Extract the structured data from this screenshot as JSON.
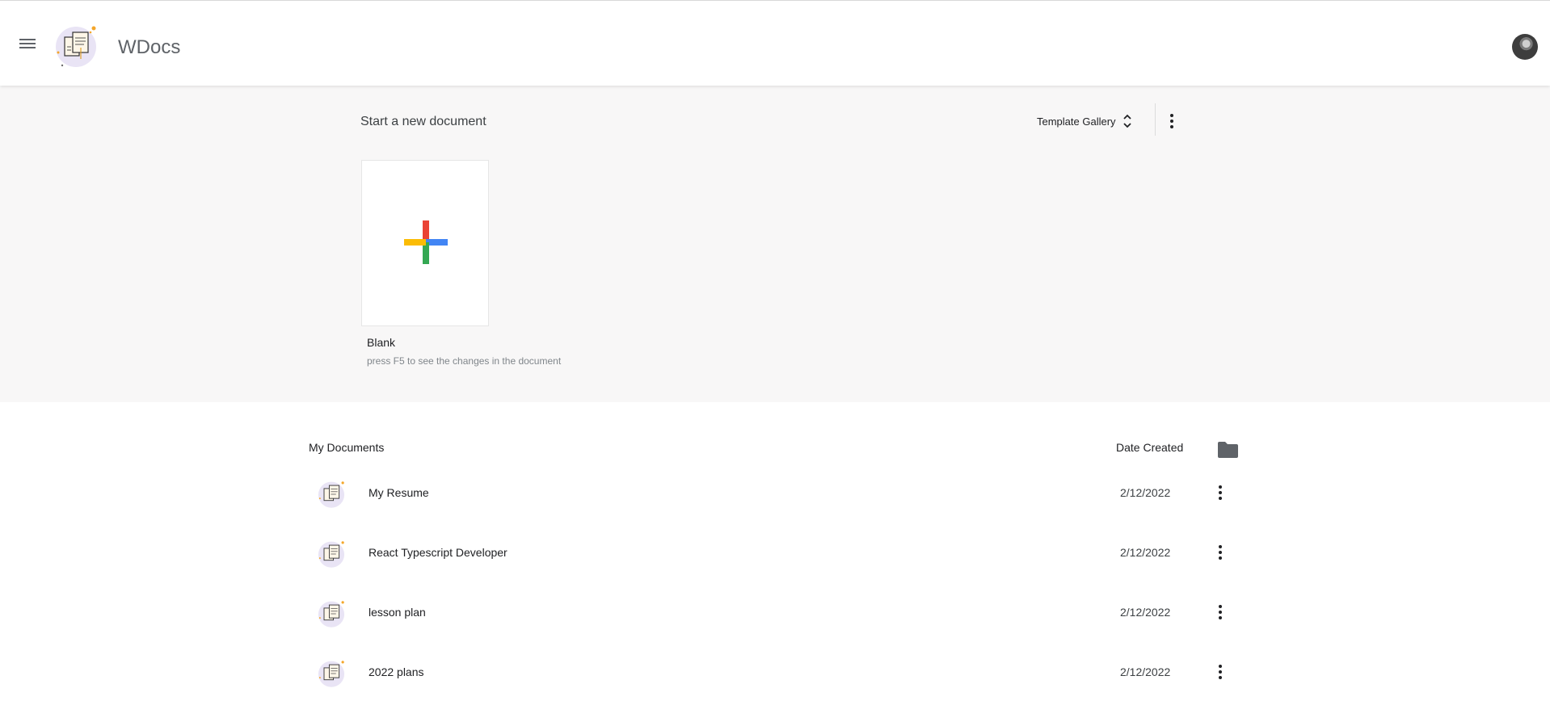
{
  "header": {
    "app_title": "WDocs",
    "menu_icon": "hamburger-menu-icon",
    "logo_icon": "documents-logo-icon",
    "avatar_icon": "user-avatar-icon"
  },
  "new_document": {
    "title": "Start a new document",
    "template_gallery_label": "Template Gallery",
    "template_gallery_icon": "unfold-chevrons-icon",
    "more_icon": "more-vertical-icon",
    "blank_label": "Blank",
    "blank_hint": "press F5 to see the changes in the document",
    "plus_colors": {
      "top": "#ea4335",
      "right": "#4285f4",
      "bottom": "#34a853",
      "left": "#fbbc05"
    }
  },
  "documents": {
    "heading": "My Documents",
    "date_heading": "Date Created",
    "folder_icon": "folder-icon",
    "rows": [
      {
        "name": "My Resume",
        "date": "2/12/2022"
      },
      {
        "name": "React Typescript Developer",
        "date": "2/12/2022"
      },
      {
        "name": "lesson plan",
        "date": "2/12/2022"
      },
      {
        "name": "2022 plans",
        "date": "2/12/2022"
      }
    ]
  }
}
